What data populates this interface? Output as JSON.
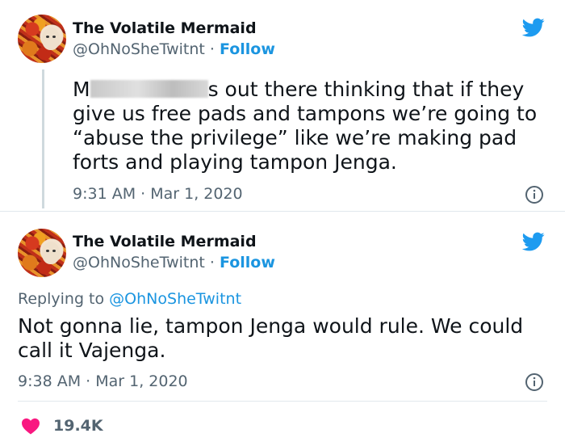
{
  "tweets": [
    {
      "author_name": "The Volatile Mermaid",
      "handle": "@OhNoSheTwitnt",
      "separator": "·",
      "follow_label": "Follow",
      "text_prefix": "M",
      "text_main": "s out there thinking that if they give us free pads and tampons we’re going to “abuse the privilege” like we’re making pad forts and playing tampon Jenga.",
      "time": "9:31 AM · Mar 1, 2020"
    },
    {
      "author_name": "The Volatile Mermaid",
      "handle": "@OhNoSheTwitnt",
      "separator": "·",
      "follow_label": "Follow",
      "replying_prefix": "Replying to",
      "replying_to": "@OhNoSheTwitnt",
      "text": "Not gonna lie, tampon Jenga would rule. We could call it Vajenga.",
      "time": "9:38 AM · Mar 1, 2020",
      "likes": "19.4K"
    }
  ],
  "colors": {
    "twitter_blue": "#1d9bf0",
    "link_blue": "#1b95e0",
    "heart_red": "#f91880"
  },
  "icons": [
    "twitter-bird-icon",
    "info-icon",
    "heart-icon"
  ]
}
